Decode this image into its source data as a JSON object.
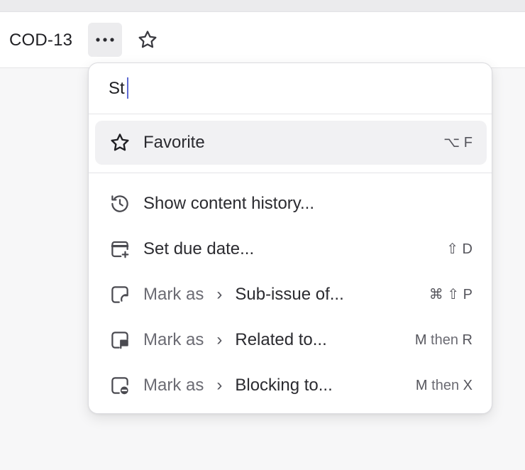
{
  "header": {
    "issue_id": "COD-13",
    "more_icon": "more-horizontal-icon",
    "star_icon": "star-icon"
  },
  "menu": {
    "search_value": "St",
    "items": [
      {
        "icon": "star-icon",
        "prefix": "",
        "label": "Favorite",
        "shortcut": "⌥ F",
        "active": true
      },
      {
        "icon": "history-icon",
        "prefix": "",
        "label": "Show content history...",
        "shortcut": ""
      },
      {
        "icon": "calendar-add-icon",
        "prefix": "",
        "label": "Set due date...",
        "shortcut": "⇧ D"
      },
      {
        "icon": "sub-issue-icon",
        "prefix": "Mark as",
        "label": "Sub-issue of...",
        "shortcut": "⌘ ⇧ P"
      },
      {
        "icon": "related-icon",
        "prefix": "Mark as",
        "label": "Related to...",
        "shortcut_key1": "M",
        "shortcut_then": "then",
        "shortcut_key2": "R"
      },
      {
        "icon": "blocking-icon",
        "prefix": "Mark as",
        "label": "Blocking to...",
        "shortcut_key1": "M",
        "shortcut_then": "then",
        "shortcut_key2": "X"
      }
    ]
  },
  "colors": {
    "accent_caret": "#5e6ad2",
    "active_row_bg": "#f1f1f3"
  }
}
